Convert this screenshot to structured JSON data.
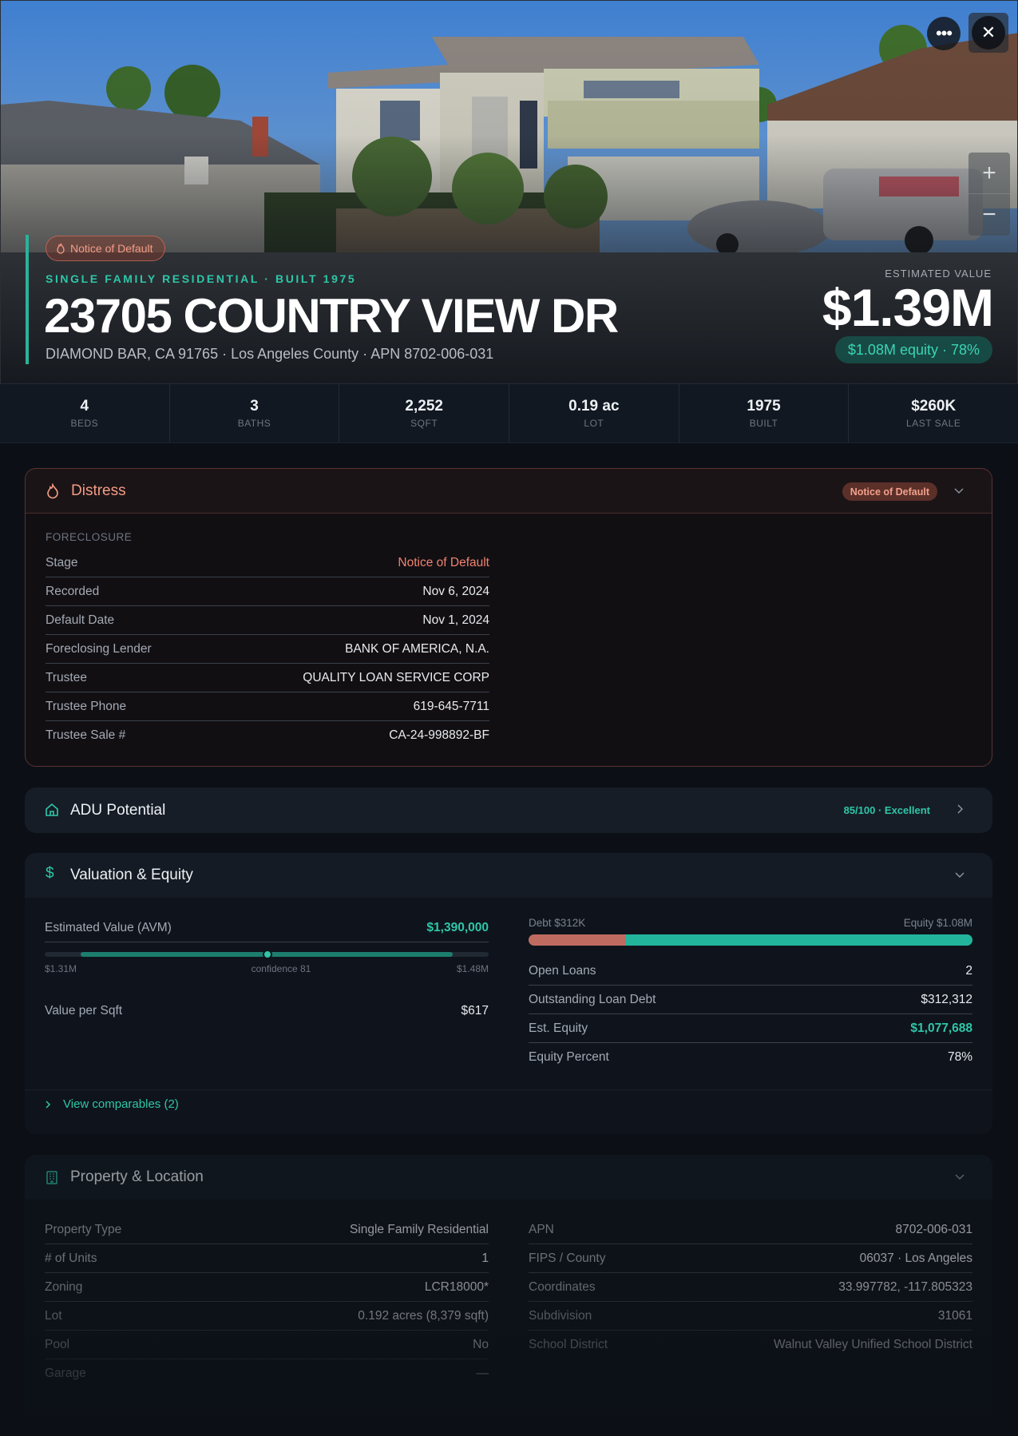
{
  "hero": {
    "status_chip": "Notice of Default",
    "subtitle": "SINGLE FAMILY RESIDENTIAL · BUILT 1975",
    "title": "23705 COUNTRY VIEW DR",
    "address_line": "DIAMOND BAR, CA 91765 · Los Angeles County · APN 8702-006-031",
    "estimated_value_label": "ESTIMATED VALUE",
    "estimated_value": "$1.39M",
    "equity_chip": "$1.08M equity · 78%",
    "icons": {
      "more": "more-icon",
      "close": "close-icon",
      "zoom_in": "plus-icon",
      "zoom_out": "minus-icon",
      "chip": "flame-icon"
    }
  },
  "stats": [
    {
      "value": "4",
      "label": "BEDS"
    },
    {
      "value": "3",
      "label": "BATHS"
    },
    {
      "value": "2,252",
      "label": "SQFT"
    },
    {
      "value": "0.19 ac",
      "label": "LOT"
    },
    {
      "value": "1975",
      "label": "BUILT"
    },
    {
      "value": "$260K",
      "label": "LAST SALE"
    }
  ],
  "distress": {
    "title": "Distress",
    "badge": "Notice of Default",
    "section_label": "FORECLOSURE",
    "rows": [
      {
        "k": "Stage",
        "v": "Notice of Default"
      },
      {
        "k": "Recorded",
        "v": "Nov 6, 2024"
      },
      {
        "k": "Default Date",
        "v": "Nov 1, 2024"
      },
      {
        "k": "Foreclosing Lender",
        "v": "BANK OF AMERICA, N.A."
      },
      {
        "k": "Trustee",
        "v": "QUALITY LOAN SERVICE CORP"
      },
      {
        "k": "Trustee Phone",
        "v": "619-645-7711"
      },
      {
        "k": "Trustee Sale #",
        "v": "CA-24-998892-BF"
      }
    ]
  },
  "adu": {
    "title": "ADU Potential",
    "badge": "85/100 · Excellent"
  },
  "valuation": {
    "title": "Valuation & Equity",
    "avm_label": "Estimated Value (AVM)",
    "avm_value": "$1,390,000",
    "range_low": "$1.31M",
    "confidence": "confidence 81",
    "range_high": "$1.48M",
    "confidence_level": 0.81,
    "per_sqft_label": "Value per Sqft",
    "per_sqft_value": "$617",
    "debt_label": "Debt $312K",
    "equity_label": "Equity $1.08M",
    "debt_fraction": 0.22,
    "rows": [
      {
        "k": "Open Loans",
        "v": "2"
      },
      {
        "k": "Outstanding Loan Debt",
        "v": "$312,312"
      },
      {
        "k": "Est. Equity",
        "v": "$1,077,688"
      },
      {
        "k": "Equity Percent",
        "v": "78%"
      }
    ],
    "comparables_link": "View comparables (2)"
  },
  "property": {
    "title": "Property & Location",
    "left_rows": [
      {
        "k": "Property Type",
        "v": "Single Family Residential"
      },
      {
        "k": "# of Units",
        "v": "1"
      },
      {
        "k": "Zoning",
        "v": "LCR18000*"
      },
      {
        "k": "Lot",
        "v": "0.192 acres (8,379 sqft)"
      },
      {
        "k": "Pool",
        "v": "No"
      },
      {
        "k": "Garage",
        "v": "—"
      }
    ],
    "right_rows": [
      {
        "k": "APN",
        "v": "8702-006-031"
      },
      {
        "k": "FIPS / County",
        "v": "06037 · Los Angeles"
      },
      {
        "k": "Coordinates",
        "v": "33.997782, -117.805323"
      },
      {
        "k": "Subdivision",
        "v": "31061"
      },
      {
        "k": "School District",
        "v": "Walnut Valley Unified School District"
      }
    ]
  },
  "colors": {
    "accent": "#2fc6a8",
    "danger": "#f39c86",
    "background": "#0c1016"
  }
}
